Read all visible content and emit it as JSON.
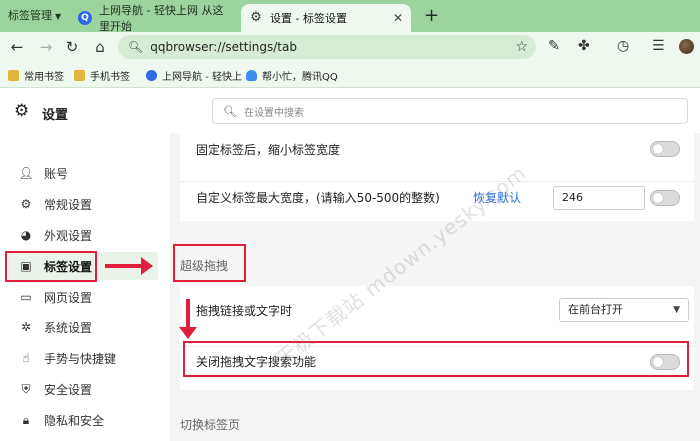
{
  "tabstrip": {
    "group_label": "标签管理",
    "tabs": [
      {
        "title": "上网导航 - 轻快上网 从这里开始",
        "favicon": "qq-browser-icon"
      },
      {
        "title": "设置 - 标签设置",
        "favicon": "gear-icon"
      }
    ],
    "new_tab": "+",
    "close": "✕"
  },
  "toolbar": {
    "url": "qqbrowser://settings/tab"
  },
  "bookmarks": [
    {
      "label": "常用书签",
      "icon": "folder-icon"
    },
    {
      "label": "手机书签",
      "icon": "folder-icon"
    },
    {
      "label": "上网导航 - 轻快上",
      "icon": "qq-browser-icon"
    },
    {
      "label": "帮小忙，腾讯QQ",
      "icon": "cloud-icon"
    }
  ],
  "settings": {
    "title": "设置",
    "search_placeholder": "在设置中搜索"
  },
  "sidebar": {
    "items": [
      {
        "label": "账号",
        "icon": "person-icon"
      },
      {
        "label": "常规设置",
        "icon": "gear-icon"
      },
      {
        "label": "外观设置",
        "icon": "palette-icon"
      },
      {
        "label": "标签设置",
        "icon": "tab-icon",
        "active": true
      },
      {
        "label": "网页设置",
        "icon": "webpage-icon"
      },
      {
        "label": "系统设置",
        "icon": "system-gear-icon"
      },
      {
        "label": "手势与快捷键",
        "icon": "hand-icon"
      },
      {
        "label": "安全设置",
        "icon": "shield-icon"
      },
      {
        "label": "隐私和安全",
        "icon": "lock-icon"
      }
    ]
  },
  "content": {
    "pin_shrink_label": "固定标签后，缩小标签宽度",
    "max_width_label": "自定义标签最大宽度，(请输入50-500的整数)",
    "restore_default": "恢复默认",
    "max_width_value": "246",
    "drag_section_title": "超级拖拽",
    "drag_link_label": "拖拽链接或文字时",
    "drag_link_option": "在前台打开",
    "disable_drag_search_label": "关闭拖拽文字搜索功能",
    "switch_section_title": "切换标签页"
  },
  "watermark": "天极下载站 mdown.yesky.com",
  "colors": {
    "tabstrip_bg": "#9dd39c",
    "toolbar_bg": "#eef8ee",
    "annotation_red": "#e0203a",
    "link_blue": "#2a6fd6"
  }
}
